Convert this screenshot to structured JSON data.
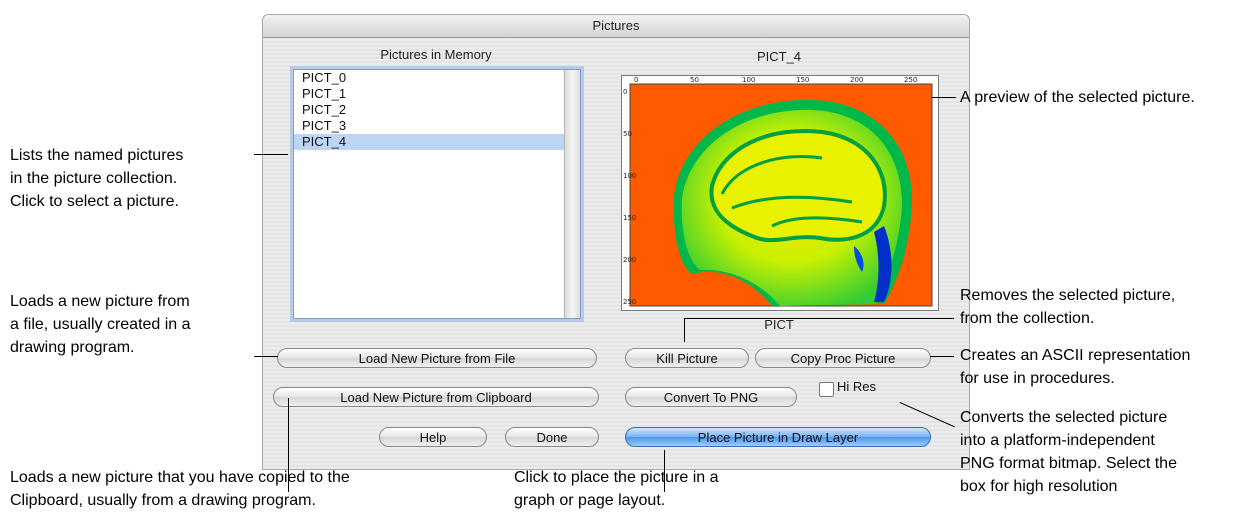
{
  "window": {
    "title": "Pictures"
  },
  "list_panel": {
    "title": "Pictures in Memory",
    "items": [
      "PICT_0",
      "PICT_1",
      "PICT_2",
      "PICT_3",
      "PICT_4"
    ],
    "selected_index": 4
  },
  "preview_panel": {
    "title": "PICT_4",
    "type_label": "PICT",
    "top_ticks": [
      "0",
      "50",
      "100",
      "150",
      "200",
      "250"
    ],
    "left_ticks": [
      "0",
      "50",
      "100",
      "150",
      "200",
      "250"
    ]
  },
  "buttons": {
    "load_file": "Load New Picture from File",
    "load_clipboard": "Load New Picture from Clipboard",
    "help": "Help",
    "done": "Done",
    "kill": "Kill Picture",
    "copy_proc": "Copy Proc Picture",
    "convert_png": "Convert To PNG",
    "hi_res": "Hi Res",
    "place": "Place Picture in Draw Layer"
  },
  "hi_res_checked": false,
  "annotations": {
    "list": [
      "Lists the named pictures",
      "in the picture collection.",
      "Click to select a picture."
    ],
    "load_file": [
      "Loads a new picture from",
      "a file, usually created in a",
      "drawing program."
    ],
    "load_clipboard": [
      "Loads a new picture that you have copied to the",
      "Clipboard, usually from a drawing program."
    ],
    "place": [
      "Click to place the picture in a",
      "graph or page layout."
    ],
    "preview": [
      "A preview of the selected picture."
    ],
    "kill": [
      "Removes the selected picture,",
      "from the collection."
    ],
    "copy_proc": [
      "Creates an ASCII representation",
      "for use in procedures."
    ],
    "convert": [
      "Converts the selected picture",
      "into a platform-independent",
      "PNG format bitmap. Select the",
      "box for high resolution"
    ]
  },
  "colors": {
    "list_selection": "#bdd5f5",
    "focus_ring": "#b7cbe8",
    "primary_button": "#4f96ec",
    "image_background": "#ff5a00",
    "image_foreground": "#ffee00",
    "image_highlight": "#00d040"
  }
}
